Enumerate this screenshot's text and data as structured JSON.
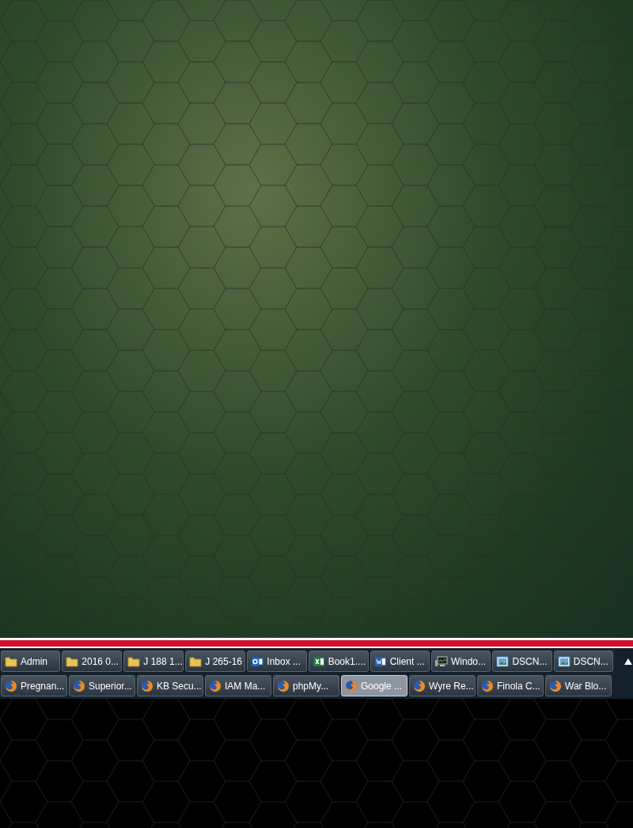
{
  "taskbar": {
    "rows": [
      {
        "items": [
          {
            "label": "Admin",
            "kind": "folder",
            "selected": false
          },
          {
            "label": "2016 0...",
            "kind": "folder",
            "selected": false
          },
          {
            "label": "J 188 1...",
            "kind": "folder",
            "selected": false
          },
          {
            "label": "J 265-16",
            "kind": "folder",
            "selected": false
          },
          {
            "label": "Inbox ...",
            "kind": "mail",
            "selected": false
          },
          {
            "label": "Book1....",
            "kind": "sheet",
            "selected": false
          },
          {
            "label": "Client ...",
            "kind": "doc",
            "selected": false
          },
          {
            "label": "Windo...",
            "kind": "monitor",
            "selected": false
          },
          {
            "label": "DSCN...",
            "kind": "image",
            "selected": false
          },
          {
            "label": "DSCN...",
            "kind": "image",
            "selected": false
          }
        ]
      },
      {
        "items": [
          {
            "label": "Pregnan...",
            "kind": "browser",
            "selected": false
          },
          {
            "label": "Superior...",
            "kind": "browser",
            "selected": false
          },
          {
            "label": "KB Secu...",
            "kind": "browser",
            "selected": false
          },
          {
            "label": "IAM Ma...",
            "kind": "browser",
            "selected": false
          },
          {
            "label": "phpMy...",
            "kind": "browser",
            "selected": false
          },
          {
            "label": "Google ...",
            "kind": "browser",
            "selected": true
          },
          {
            "label": "Wyre Re...",
            "kind": "browser",
            "selected": false
          },
          {
            "label": "Finola C...",
            "kind": "browser",
            "selected": false
          },
          {
            "label": "War Blo...",
            "kind": "browser",
            "selected": false
          }
        ]
      }
    ]
  }
}
